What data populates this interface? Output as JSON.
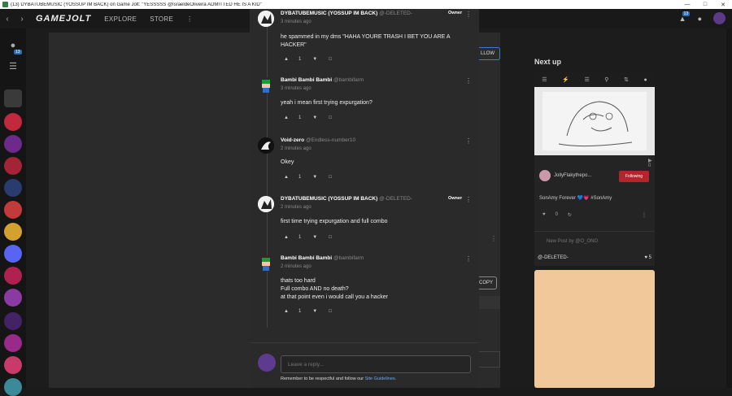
{
  "window": {
    "title": "(13) DYBATUBEMUSIC (YOSSUP IM BACK) on Game Jolt: \"YESSSSS @IsraeldeOliveira ADMITTED HE IS A KID\"",
    "controls": [
      "—",
      "□",
      "✕"
    ]
  },
  "nav": {
    "logo": "GAMEJOLT",
    "explore": "EXPLORE",
    "store": "STORE",
    "notif_count": "13"
  },
  "sidebar": {
    "badge": "13"
  },
  "background": {
    "follow_label": "LLOW",
    "copy_label": "COPY",
    "dots": "⋮"
  },
  "next_up": {
    "title": "Next up",
    "bar_icons": [
      "☰",
      "⚡",
      "☰",
      "⚲",
      "⇅",
      "●"
    ],
    "views": "▶ 0",
    "user": "JollyFlakythepo...",
    "following_label": "Following",
    "caption": "SonAmy Forever 💙💗 #SonAmy",
    "actions": [
      "♥",
      "0",
      "↻",
      "⋮"
    ],
    "nested_text": "New Post by @O_ONO",
    "nested_author": "@-DELETED-",
    "nested_likes": "♥ 5"
  },
  "comments": [
    {
      "name": "DYBATUBEMUSIC (YOSSUP IM BACK)",
      "handle": "@-DELETED-",
      "time": "3 minutes ago",
      "owner": "Owner",
      "body": [
        "he spammed in my dms \"HAHA YOURE TRASH I BET YOU ARE A",
        "HACKER\""
      ],
      "likes": "1"
    },
    {
      "name": "Bambi Bambi Bambi",
      "handle": "@bambifarm",
      "time": "3 minutes ago",
      "owner": "",
      "body": [
        "yeah i mean first trying expurgation?"
      ],
      "likes": "1"
    },
    {
      "name": "Void-zero",
      "handle": "@Endless-number10",
      "time": "2 minutes ago",
      "owner": "",
      "body": [
        "Okey"
      ],
      "likes": "1"
    },
    {
      "name": "DYBATUBEMUSIC (YOSSUP IM BACK)",
      "handle": "@-DELETED-",
      "time": "2 minutes ago",
      "owner": "Owner",
      "body": [
        "first time trying expurgation and full combo"
      ],
      "likes": "1"
    },
    {
      "name": "Bambi Bambi Bambi",
      "handle": "@bambifarm",
      "time": "2 minutes ago",
      "owner": "",
      "body": [
        "thats too hard",
        "Full combo AND no death?",
        "at that point even i would call you a hacker"
      ],
      "likes": "1"
    }
  ],
  "reply": {
    "placeholder": "Leave a reply...",
    "note_prefix": "Remember to be respectful and follow our ",
    "note_link": "Site Guidelines",
    "note_suffix": "."
  },
  "colors": {
    "accent": "#3a7bd5",
    "following": "#b4252b",
    "link": "#6aaaf5"
  }
}
